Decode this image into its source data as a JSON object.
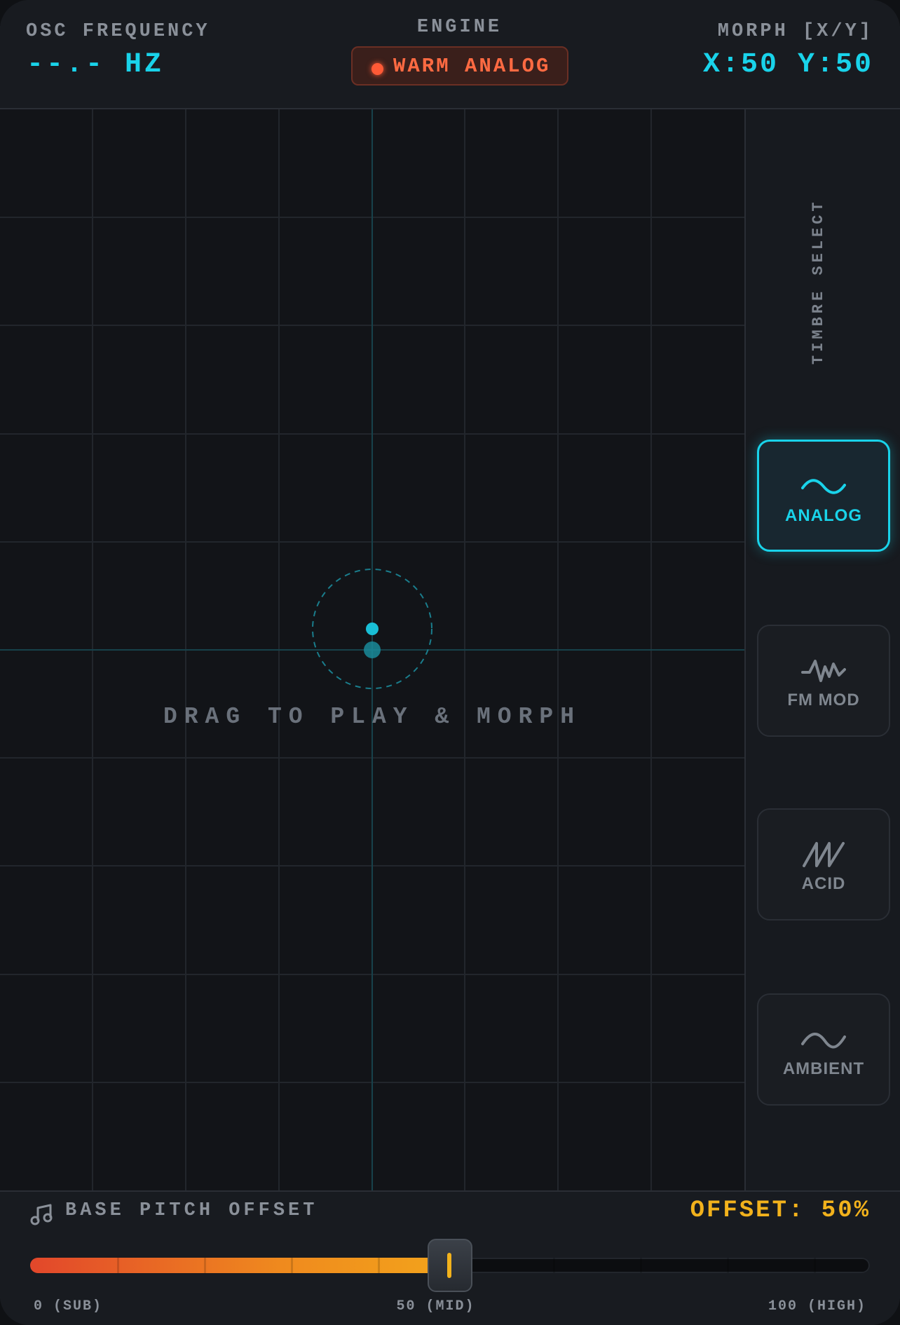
{
  "header": {
    "freq_label": "OSC FREQUENCY",
    "freq_value": "--.- HZ",
    "engine_label": "ENGINE",
    "engine_value": "WARM ANALOG",
    "morph_label": "MORPH [X/Y]",
    "morph_value": "X:50 Y:50"
  },
  "pad": {
    "hint": "DRAG TO PLAY & MORPH",
    "x": 50,
    "y": 50
  },
  "sidebar": {
    "title": "TIMBRE SELECT",
    "items": [
      {
        "label": "ANALOG",
        "icon": "sine-wave-icon",
        "active": true
      },
      {
        "label": "FM MOD",
        "icon": "fm-wave-icon",
        "active": false
      },
      {
        "label": "ACID",
        "icon": "sawtooth-wave-icon",
        "active": false
      },
      {
        "label": "AMBIENT",
        "icon": "soft-wave-icon",
        "active": false
      }
    ]
  },
  "pitch": {
    "label": "BASE PITCH OFFSET",
    "icon": "music-note-icon",
    "offset_text": "OFFSET: 50%",
    "value": 50,
    "min_label": "0 (SUB)",
    "mid_label": "50 (MID)",
    "max_label": "100 (HIGH)"
  },
  "colors": {
    "accent": "#19d3ea",
    "engine": "#ff5a36",
    "offset": "#f2b21c",
    "background": "#15181d"
  }
}
